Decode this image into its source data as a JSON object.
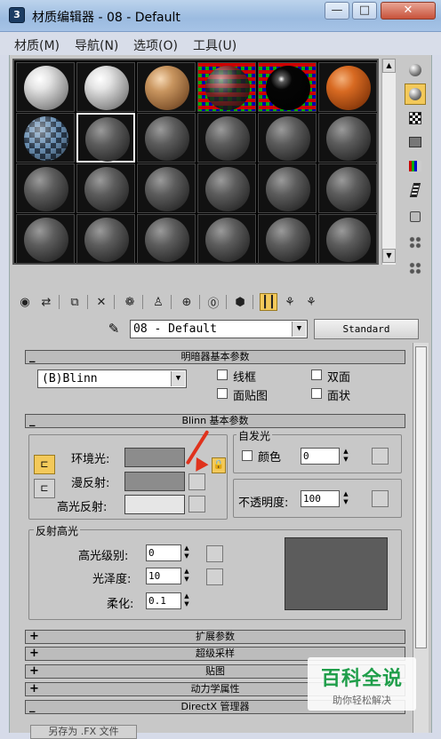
{
  "window": {
    "title": "材质编辑器 - 08 - Default",
    "app_icon": "3ds-max-icon"
  },
  "menubar": [
    "材质(M)",
    "导航(N)",
    "选项(O)",
    "工具(U)"
  ],
  "toolbar": {
    "icons": [
      "get-material-icon",
      "put-to-scene-icon",
      "assign-material-icon",
      "reset-icon",
      "copy-material-icon",
      "make-unique-icon",
      "put-to-library-icon",
      "material-id-icon",
      "show-map-icon",
      "show-end-result-icon",
      "go-to-parent-icon",
      "go-forward-icon",
      "pick-by-material-icon"
    ]
  },
  "material": {
    "name": "08 - Default",
    "type_button": "Standard"
  },
  "rollouts": {
    "shader_basic": "明暗器基本参数",
    "blinn_basic": "Blinn 基本参数",
    "extended": "扩展参数",
    "supersampling": "超级采样",
    "maps": "贴图",
    "dynamics": "动力学属性",
    "directx": "DirectX 管理器"
  },
  "shader": {
    "selected": "(B)Blinn",
    "wire": "线框",
    "two_sided": "双面",
    "face_map": "面贴图",
    "faceted": "面状"
  },
  "blinn": {
    "ambient": "环境光:",
    "diffuse": "漫反射:",
    "specular": "高光反射:",
    "self_illum_group": "自发光",
    "color": "颜色",
    "self_illum_value": "0",
    "opacity": "不透明度:",
    "opacity_value": "100",
    "spec_group": "反射高光",
    "spec_level": "高光级别:",
    "spec_level_value": "0",
    "glossiness": "光泽度:",
    "glossiness_value": "10",
    "soften": "柔化:",
    "soften_value": "0.1",
    "lock_icon": "lock-icon"
  },
  "colors": {
    "ambient": "#8c8c8c",
    "diffuse": "#8c8c8c",
    "specular": "#e6e6e6",
    "active": "#f3c95a"
  },
  "watermark": {
    "title": "百科全说",
    "subtitle": "助你轻松解决"
  },
  "footer": {
    "button": "另存为 .FX 文件"
  }
}
